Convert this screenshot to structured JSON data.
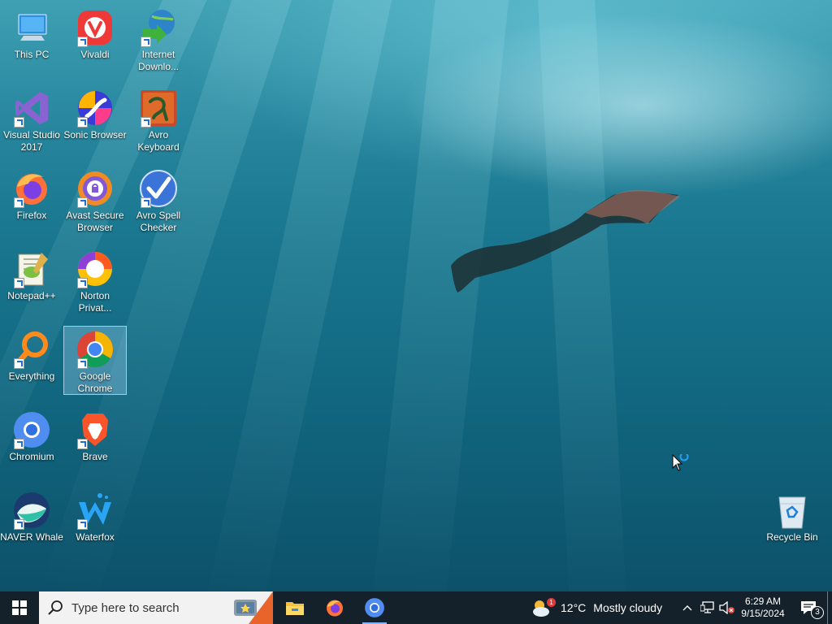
{
  "desktop": {
    "icons": [
      {
        "label": "This PC",
        "icon": "this-pc-icon"
      },
      {
        "label": "Vivaldi",
        "icon": "vivaldi-icon"
      },
      {
        "label": "Internet Downlo...",
        "icon": "internet-download-manager-icon"
      },
      {
        "label": "Visual Studio 2017",
        "icon": "visual-studio-icon"
      },
      {
        "label": "Sonic Browser",
        "icon": "sonic-browser-icon"
      },
      {
        "label": "Avro Keyboard",
        "icon": "avro-keyboard-icon"
      },
      {
        "label": "Firefox",
        "icon": "firefox-icon"
      },
      {
        "label": "Avast Secure Browser",
        "icon": "avast-browser-icon"
      },
      {
        "label": "Avro Spell Checker",
        "icon": "avro-spell-checker-icon"
      },
      {
        "label": "Notepad++",
        "icon": "notepad-plus-plus-icon"
      },
      {
        "label": "Norton Privat...",
        "icon": "norton-private-browser-icon"
      },
      {
        "label": "Everything",
        "icon": "everything-search-icon"
      },
      {
        "label": "Google Chrome",
        "icon": "google-chrome-icon",
        "selected": true
      },
      {
        "label": "Chromium",
        "icon": "chromium-icon"
      },
      {
        "label": "Brave",
        "icon": "brave-icon"
      },
      {
        "label": "NAVER Whale",
        "icon": "naver-whale-icon"
      },
      {
        "label": "Waterfox",
        "icon": "waterfox-icon"
      },
      {
        "label": "Recycle Bin",
        "icon": "recycle-bin-icon"
      }
    ]
  },
  "taskbar": {
    "search_placeholder": "Type here to search",
    "pinned": [
      "file-explorer-icon",
      "firefox-icon",
      "chromium-icon"
    ],
    "weather": {
      "temp": "12°C",
      "condition": "Mostly cloudy",
      "badge": "1"
    },
    "clock": {
      "time": "6:29 AM",
      "date": "9/15/2024"
    },
    "notifications_count": "3"
  }
}
